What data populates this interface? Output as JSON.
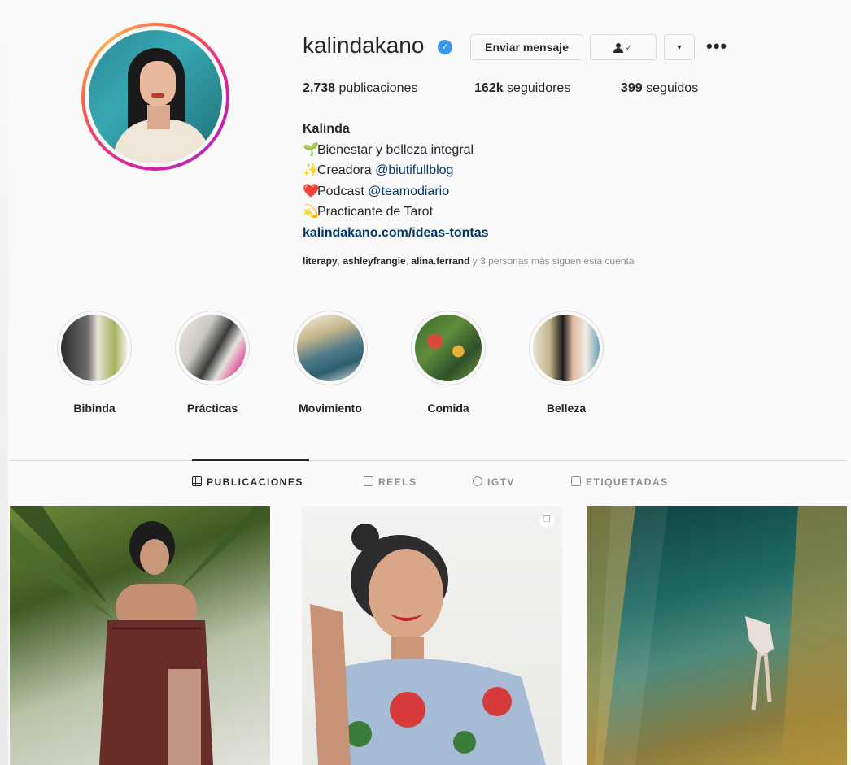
{
  "profile": {
    "username": "kalindakano",
    "verified_icon": "verified-badge-icon",
    "message_button": "Enviar mensaje",
    "follow_icon": "person-check-icon",
    "dropdown_icon": "▼",
    "more_icon": "•••",
    "stats": [
      {
        "count": "2,738",
        "label": "publicaciones"
      },
      {
        "count": "162k",
        "label": "seguidores"
      },
      {
        "count": "399",
        "label": "seguidos"
      }
    ],
    "bio": {
      "name": "Kalinda",
      "lines": [
        {
          "emoji": "🌱",
          "text": "Bienestar y belleza integral",
          "mention": ""
        },
        {
          "emoji": "✨",
          "text": "Creadora ",
          "mention": "@biutifullblog"
        },
        {
          "emoji": "❤️",
          "text": "Podcast ",
          "mention": "@teamodiario"
        },
        {
          "emoji": "💫",
          "text": "Practicante de Tarot",
          "mention": ""
        }
      ],
      "link": "kalindakano.com/ideas-tontas"
    },
    "followed_by": {
      "users": [
        "literapy",
        "ashleyfrangie",
        "alina.ferrand"
      ],
      "suffix": "y 3 personas más siguen esta cuenta"
    }
  },
  "highlights": [
    {
      "label": "Bibinda"
    },
    {
      "label": "Prácticas"
    },
    {
      "label": "Movimiento"
    },
    {
      "label": "Comida"
    },
    {
      "label": "Belleza"
    }
  ],
  "tabs": [
    {
      "label": "PUBLICACIONES",
      "icon": "grid-icon",
      "active": true
    },
    {
      "label": "REELS",
      "icon": "reels-icon",
      "active": false
    },
    {
      "label": "IGTV",
      "icon": "igtv-icon",
      "active": false
    },
    {
      "label": "ETIQUETADAS",
      "icon": "tagged-icon",
      "active": false
    }
  ],
  "colors": {
    "link": "#00376b",
    "muted": "#8e8e8e",
    "text": "#262626",
    "verified": "#3897f0",
    "border": "#dbdbdb"
  }
}
